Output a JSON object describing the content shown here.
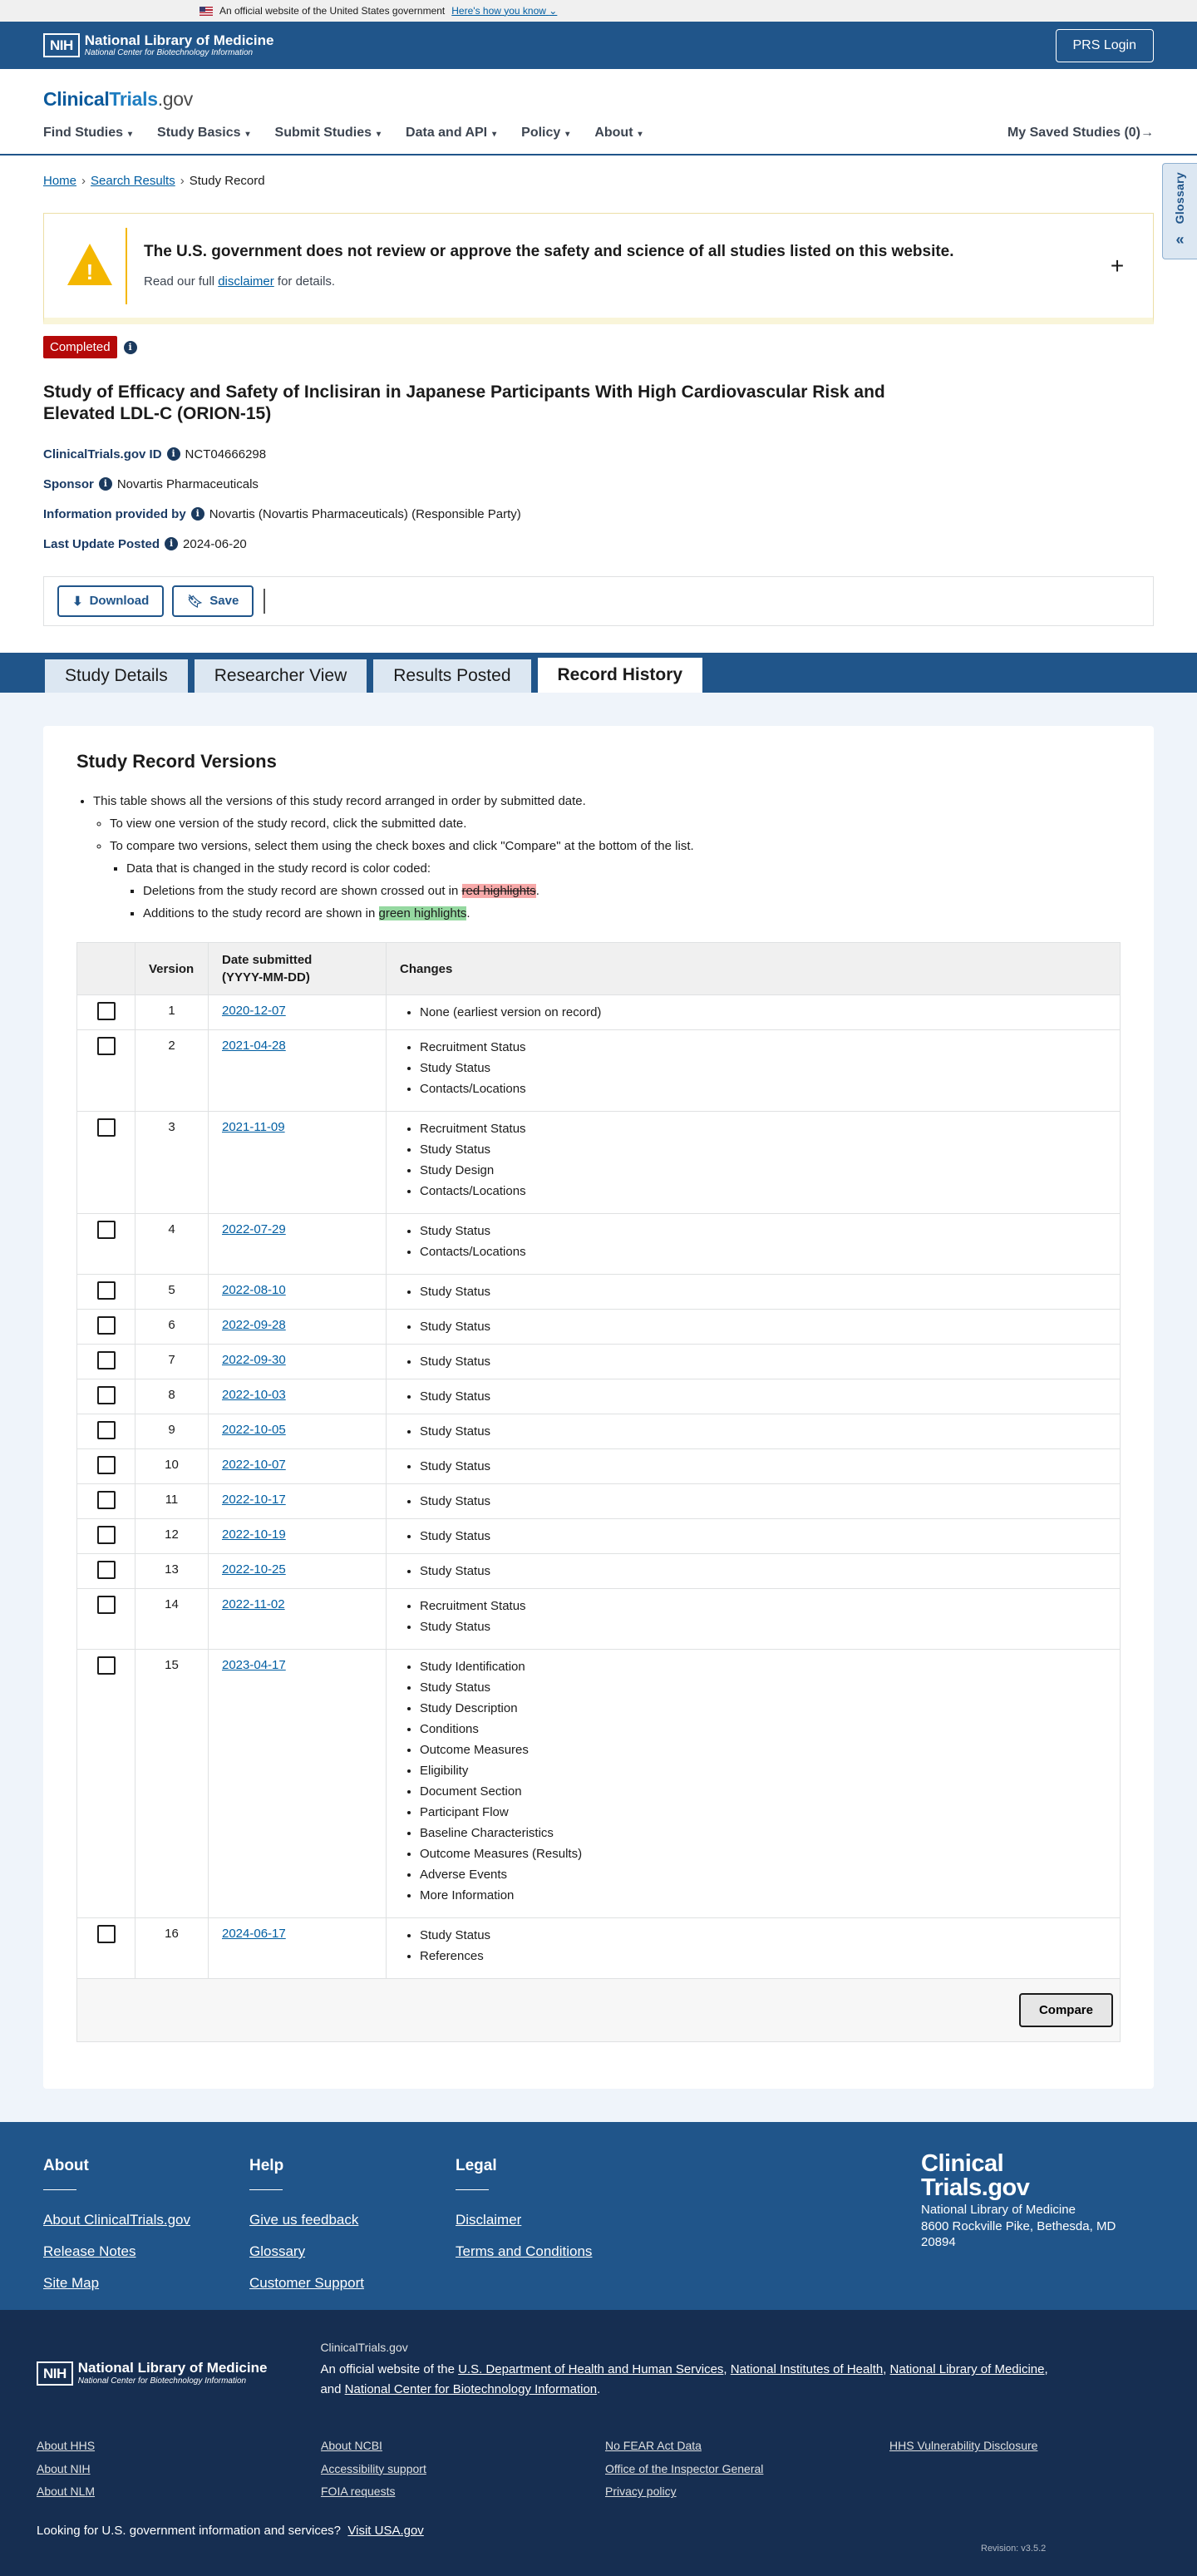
{
  "gov_banner": {
    "text": "An official website of the United States government",
    "link": "Here's how you know"
  },
  "nih": {
    "abbr": "NIH",
    "name": "National Library of Medicine",
    "sub": "National Center for Biotechnology Information",
    "prs_login": "PRS Login"
  },
  "ct": {
    "logo_a": "Clinical",
    "logo_b": "Trials",
    "logo_c": ".gov",
    "nav": [
      "Find Studies",
      "Study Basics",
      "Submit Studies",
      "Data and API",
      "Policy",
      "About"
    ],
    "saved": "My Saved Studies (0)"
  },
  "breadcrumb": {
    "home": "Home",
    "search": "Search Results",
    "current": "Study Record"
  },
  "glossary": "Glossary",
  "alert": {
    "title": "The U.S. government does not review or approve the safety and science of all studies listed on this website.",
    "pre": "Read our full ",
    "link": "disclaimer",
    "post": " for details."
  },
  "study": {
    "status": "Completed",
    "title": "Study of Efficacy and Safety of Inclisiran in Japanese Participants With High Cardiovascular Risk and Elevated LDL-C (ORION-15)",
    "id_label": "ClinicalTrials.gov ID",
    "id": "NCT04666298",
    "sponsor_label": "Sponsor",
    "sponsor": "Novartis Pharmaceuticals",
    "info_label": "Information provided by",
    "info": "Novartis (Novartis Pharmaceuticals) (Responsible Party)",
    "update_label": "Last Update Posted",
    "update": "2024-06-20"
  },
  "actions": {
    "download": "Download",
    "save": "Save"
  },
  "tabs": [
    "Study Details",
    "Researcher View",
    "Results Posted",
    "Record History"
  ],
  "versions": {
    "heading": "Study Record Versions",
    "b1": "This table shows all the versions of this study record arranged in order by submitted date.",
    "b2": "To view one version of the study record, click the submitted date.",
    "b3": "To compare two versions, select them using the check boxes and click \"Compare\" at the bottom of the list.",
    "b4": "Data that is changed in the study record is color coded:",
    "b5_pre": "Deletions from the study record are shown crossed out in ",
    "b5_hl": "red highlights",
    "b5_post": ".",
    "b6_pre": "Additions to the study record are shown in ",
    "b6_hl": "green highlights",
    "b6_post": ".",
    "col_version": "Version",
    "col_date_a": "Date submitted",
    "col_date_b": "(YYYY-MM-DD)",
    "col_changes": "Changes",
    "rows": [
      {
        "v": "1",
        "date": "2020-12-07",
        "changes": [
          "None (earliest version on record)"
        ]
      },
      {
        "v": "2",
        "date": "2021-04-28",
        "changes": [
          "Recruitment Status",
          "Study Status",
          "Contacts/Locations"
        ]
      },
      {
        "v": "3",
        "date": "2021-11-09",
        "changes": [
          "Recruitment Status",
          "Study Status",
          "Study Design",
          "Contacts/Locations"
        ]
      },
      {
        "v": "4",
        "date": "2022-07-29",
        "changes": [
          "Study Status",
          "Contacts/Locations"
        ]
      },
      {
        "v": "5",
        "date": "2022-08-10",
        "changes": [
          "Study Status"
        ]
      },
      {
        "v": "6",
        "date": "2022-09-28",
        "changes": [
          "Study Status"
        ]
      },
      {
        "v": "7",
        "date": "2022-09-30",
        "changes": [
          "Study Status"
        ]
      },
      {
        "v": "8",
        "date": "2022-10-03",
        "changes": [
          "Study Status"
        ]
      },
      {
        "v": "9",
        "date": "2022-10-05",
        "changes": [
          "Study Status"
        ]
      },
      {
        "v": "10",
        "date": "2022-10-07",
        "changes": [
          "Study Status"
        ]
      },
      {
        "v": "11",
        "date": "2022-10-17",
        "changes": [
          "Study Status"
        ]
      },
      {
        "v": "12",
        "date": "2022-10-19",
        "changes": [
          "Study Status"
        ]
      },
      {
        "v": "13",
        "date": "2022-10-25",
        "changes": [
          "Study Status"
        ]
      },
      {
        "v": "14",
        "date": "2022-11-02",
        "changes": [
          "Recruitment Status",
          "Study Status"
        ]
      },
      {
        "v": "15",
        "date": "2023-04-17",
        "changes": [
          "Study Identification",
          "Study Status",
          "Study Description",
          "Conditions",
          "Outcome Measures",
          "Eligibility",
          "Document Section",
          "Participant Flow",
          "Baseline Characteristics",
          "Outcome Measures (Results)",
          "Adverse Events",
          "More Information"
        ]
      },
      {
        "v": "16",
        "date": "2024-06-17",
        "changes": [
          "Study Status",
          "References"
        ]
      }
    ],
    "compare": "Compare"
  },
  "footer": {
    "about": {
      "h": "About",
      "links": [
        "About ClinicalTrials.gov",
        "Release Notes",
        "Site Map"
      ]
    },
    "help": {
      "h": "Help",
      "links": [
        "Give us feedback",
        "Glossary",
        "Customer Support"
      ]
    },
    "legal": {
      "h": "Legal",
      "links": [
        "Disclaimer",
        "Terms and Conditions"
      ]
    },
    "brand_a": "Clinical",
    "brand_b": "Trials.gov",
    "addr1": "National Library of Medicine",
    "addr2": "8600 Rockville Pike, Bethesda, MD",
    "addr3": "20894"
  },
  "footer2": {
    "site": "ClinicalTrials.gov",
    "p_pre": "An official website of the ",
    "l1": "U.S. Department of Health and Human Services",
    "c1": ", ",
    "l2": "National Institutes of Health",
    "c2": ", ",
    "l3": "National Library of Medicine",
    "c3": ",",
    "and": "and ",
    "l4": "National Center for Biotechnology Information",
    "end": ".",
    "links": [
      "About HHS",
      "About NCBI",
      "No FEAR Act Data",
      "HHS Vulnerability Disclosure",
      "About NIH",
      "Accessibility support",
      "Office of the Inspector General",
      "",
      "About NLM",
      "FOIA requests",
      "Privacy policy",
      ""
    ],
    "usa_pre": "Looking for U.S. government information and services?",
    "usa_link": "Visit USA.gov",
    "revision": "Revision: v3.5.2"
  }
}
